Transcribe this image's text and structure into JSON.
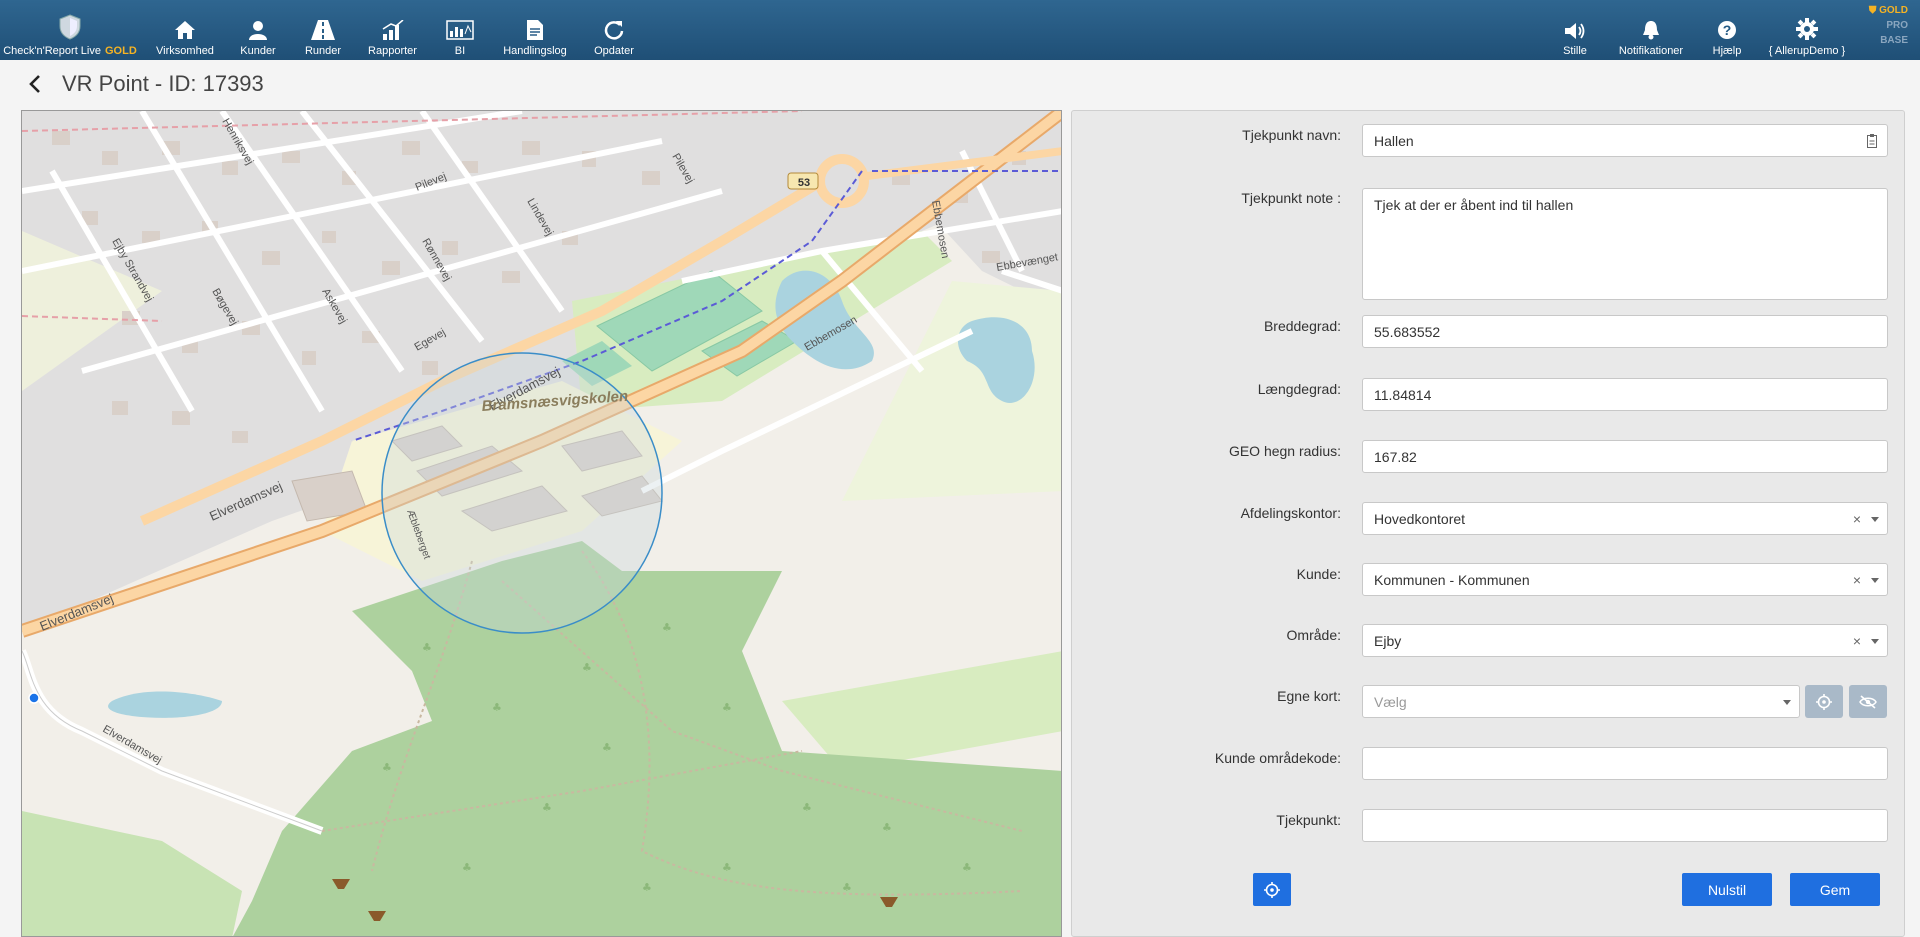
{
  "nav": {
    "brand": {
      "label": "Check'n'Report Live",
      "tag": "GOLD"
    },
    "items": [
      {
        "label": "Virksomhed",
        "icon": "home-icon"
      },
      {
        "label": "Kunder",
        "icon": "user-icon"
      },
      {
        "label": "Runder",
        "icon": "road-icon"
      },
      {
        "label": "Rapporter",
        "icon": "bar-chart-icon"
      },
      {
        "label": "BI",
        "icon": "dashboard-icon"
      },
      {
        "label": "Handlingslog",
        "icon": "document-icon"
      },
      {
        "label": "Opdater",
        "icon": "refresh-icon"
      }
    ],
    "right_items": [
      {
        "label": "Stille",
        "icon": "speaker-icon"
      },
      {
        "label": "Notifikationer",
        "icon": "bell-icon"
      },
      {
        "label": "Hjælp",
        "icon": "help-icon"
      },
      {
        "label": "{ AllerupDemo }",
        "icon": "gear-icon"
      }
    ],
    "tiers": [
      "GOLD",
      "PRO",
      "BASE"
    ],
    "colors": {
      "bar": "#1f4f76",
      "gold": "#f5b324"
    }
  },
  "page": {
    "title": "VR Point - ID: 17393"
  },
  "map": {
    "labels": {
      "road_elverdamsvej": "Elverdamsvej",
      "road_53": "53",
      "school": "Bramsnæsvigskolen",
      "road_ebbemosen": "Ebbemosen",
      "road_ebbevaenget": "Ebbevænget",
      "road_egevej": "Egevej",
      "road_askevej": "Askevej",
      "road_bogevej": "Bøgevej",
      "road_ranvej": "Rønnevej",
      "road_lindevej": "Lindevej",
      "road_pilevej": "Pilevej",
      "road_henrikvej": "Henriksvej",
      "road_ejby_strandvej": "Ejby Strandvej",
      "road_aebleberget": "Æbleberget"
    }
  },
  "form": {
    "name": {
      "label": "Tjekpunkt navn:",
      "value": "Hallen"
    },
    "note": {
      "label": "Tjekpunkt note :",
      "value": "Tjek at der er åbent ind til hallen"
    },
    "lat": {
      "label": "Breddegrad:",
      "value": "55.683552"
    },
    "lng": {
      "label": "Længdegrad:",
      "value": "11.84814"
    },
    "radius": {
      "label": "GEO hegn radius:",
      "value": "167.82"
    },
    "office": {
      "label": "Afdelingskontor:",
      "value": "Hovedkontoret"
    },
    "customer": {
      "label": "Kunde:",
      "value": "Kommunen - Kommunen"
    },
    "area": {
      "label": "Område:",
      "value": "Ejby"
    },
    "own_maps": {
      "label": "Egne kort:",
      "placeholder": "Vælg"
    },
    "area_code": {
      "label": "Kunde områdekode:",
      "value": ""
    },
    "checkpoint": {
      "label": "Tjekpunkt:",
      "value": ""
    },
    "buttons": {
      "reset": "Nulstil",
      "save": "Gem"
    },
    "colors": {
      "primary": "#1f6fe0",
      "disabled": "#a9b9c8"
    }
  }
}
